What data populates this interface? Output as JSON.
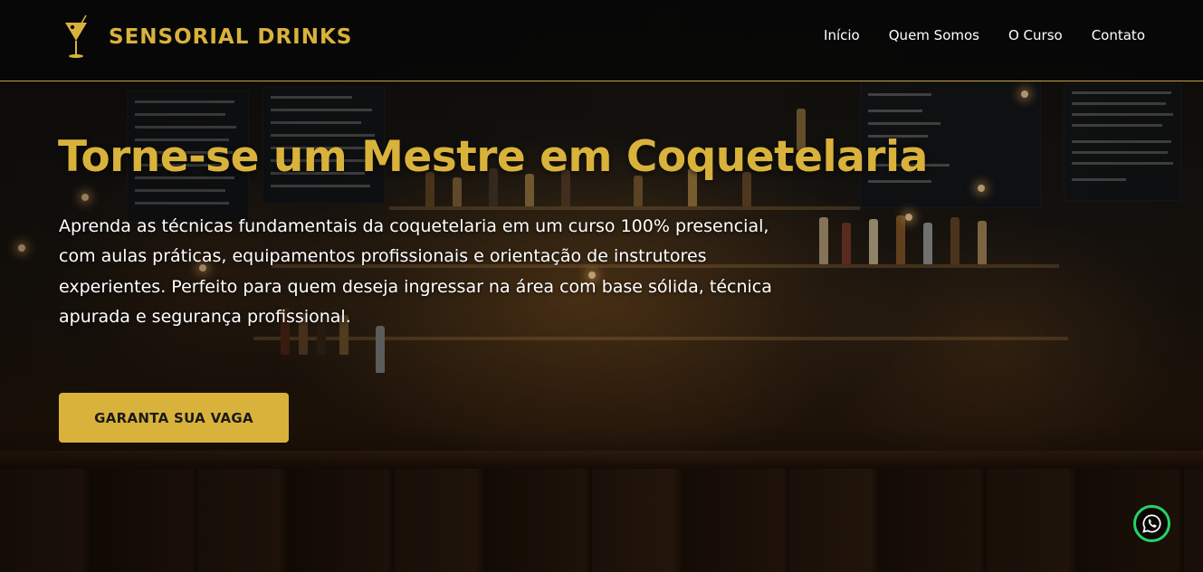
{
  "header": {
    "brand_name": "SENSORIAL DRINKS",
    "logo_icon": "cocktail-glass-icon",
    "nav": [
      {
        "label": "Início"
      },
      {
        "label": "Quem Somos"
      },
      {
        "label": "O Curso"
      },
      {
        "label": "Contato"
      }
    ]
  },
  "hero": {
    "title": "Torne-se um Mestre em Coquetelaria",
    "description": "Aprenda as técnicas fundamentais da coquetelaria em um curso 100% presencial, com aulas práticas, equipamentos profissionais e orientação de instrutores experientes. Perfeito para quem deseja ingressar na área com base sólida, técnica apurada e segurança profissional.",
    "cta_label": "GARANTA SUA VAGA"
  },
  "floating": {
    "whatsapp_icon": "whatsapp-icon"
  },
  "colors": {
    "accent": "#d9b23c",
    "header_bg": "#080808",
    "whatsapp": "#25d366",
    "text": "#ffffff"
  }
}
